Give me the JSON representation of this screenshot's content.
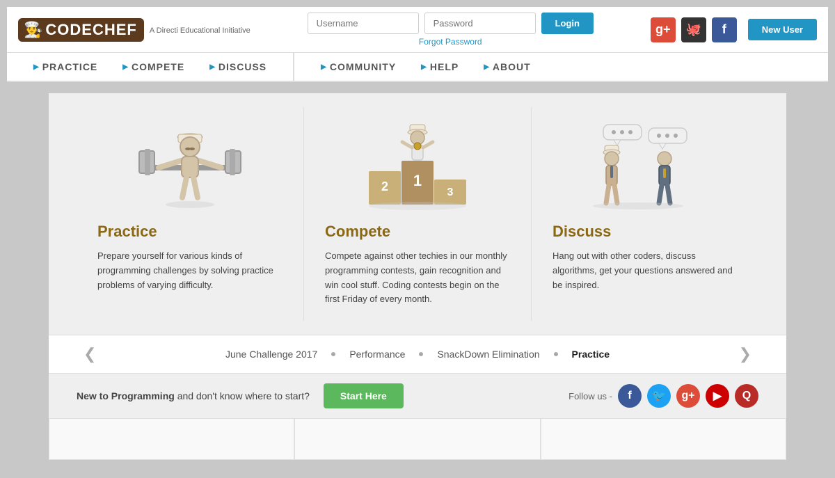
{
  "header": {
    "logo_text": "CODECHEF",
    "logo_subtitle": "A Directi Educational Initiative",
    "username_placeholder": "Username",
    "password_placeholder": "Password",
    "login_label": "Login",
    "forgot_label": "Forgot Password",
    "new_user_label": "New User",
    "social_icons": [
      {
        "name": "google-plus",
        "label": "g+",
        "class": "social-google"
      },
      {
        "name": "github",
        "label": "🐙",
        "class": "social-github"
      },
      {
        "name": "facebook",
        "label": "f",
        "class": "social-facebook"
      }
    ]
  },
  "nav": {
    "main_items": [
      {
        "id": "practice",
        "label": "PRACTICE"
      },
      {
        "id": "compete",
        "label": "COMPETE"
      },
      {
        "id": "discuss",
        "label": "DISCUSS"
      }
    ],
    "secondary_items": [
      {
        "id": "community",
        "label": "COMMUNITY"
      },
      {
        "id": "help",
        "label": "HELP"
      },
      {
        "id": "about",
        "label": "ABOUT"
      }
    ]
  },
  "cards": [
    {
      "id": "practice",
      "title": "Practice",
      "description": "Prepare yourself for various kinds of programming challenges by solving practice problems of varying difficulty."
    },
    {
      "id": "compete",
      "title": "Compete",
      "description": "Compete against other techies in our monthly programming contests, gain recognition and win cool stuff. Coding contests begin on the first Friday of every month."
    },
    {
      "id": "discuss",
      "title": "Discuss",
      "description": "Hang out with other coders, discuss algorithms, get your questions answered and be inspired."
    }
  ],
  "carousel": {
    "items": [
      {
        "label": "June Challenge 2017",
        "active": false
      },
      {
        "label": "Performance",
        "active": false
      },
      {
        "label": "SnackDown Elimination",
        "active": false
      },
      {
        "label": "Practice",
        "active": true
      }
    ]
  },
  "follow_bar": {
    "new_text": "New to Programming",
    "continue_text": "and don't know where to start?",
    "start_label": "Start Here",
    "follow_label": "Follow us -",
    "social_icons": [
      {
        "name": "facebook",
        "label": "f",
        "class": "fi-fb"
      },
      {
        "name": "twitter",
        "label": "🐦",
        "class": "fi-tw"
      },
      {
        "name": "google-plus",
        "label": "g+",
        "class": "fi-gp"
      },
      {
        "name": "youtube",
        "label": "▶",
        "class": "fi-yt"
      },
      {
        "name": "quora",
        "label": "Q",
        "class": "fi-qu"
      }
    ]
  }
}
